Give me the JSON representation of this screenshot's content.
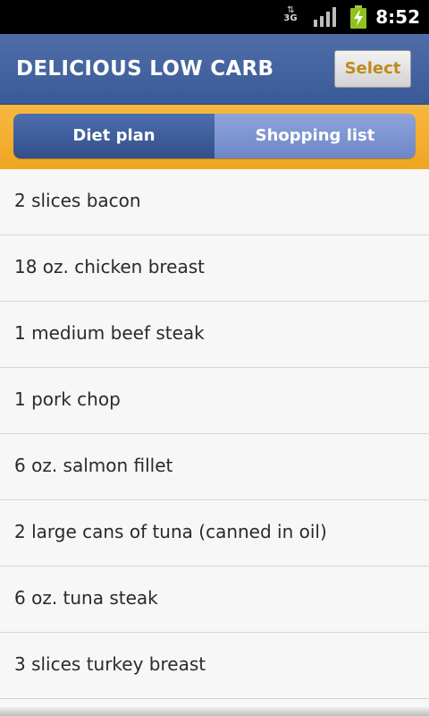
{
  "status_bar": {
    "network": "3G",
    "network_arrows": "⇅",
    "time": "8:52",
    "icons": [
      "network-3g-icon",
      "signal-icon",
      "battery-charging-icon"
    ]
  },
  "header": {
    "title": "DELICIOUS LOW CARB",
    "select_label": "Select",
    "accent_color": "#c08a1e"
  },
  "tabs": [
    {
      "label": "Diet plan",
      "selected": false
    },
    {
      "label": "Shopping list",
      "selected": true
    }
  ],
  "list": {
    "items": [
      "2 slices bacon",
      "18 oz. chicken breast",
      "1 medium beef steak",
      "1 pork chop",
      "6 oz. salmon fillet",
      "2 large cans of tuna (canned in oil)",
      "6 oz. tuna steak",
      "3 slices turkey breast"
    ]
  },
  "colors": {
    "titlebar": "#3f5f9c",
    "tabstrip": "#f3ac2e",
    "tab_active": "#7d95d1",
    "tab_inactive": "#3f5e9b"
  }
}
